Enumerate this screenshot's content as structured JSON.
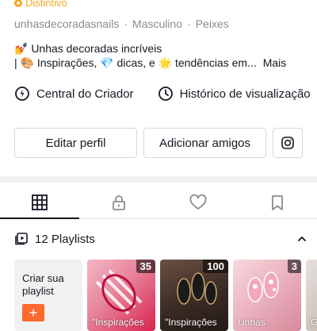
{
  "profile": {
    "badge_label": "Distintivo",
    "username": "unhasdecoradasnails",
    "gender": "Masculino",
    "sign": "Peixes",
    "bio_line1": "💅 Unhas decoradas incríveis",
    "bio_line2": "| 🎨 Inspirações, 💎 dicas, e 🌟 tendências em...",
    "bio_more": "Mais"
  },
  "links": {
    "creator_center": "Central do Criador",
    "view_history": "Histórico de visualização"
  },
  "buttons": {
    "edit_profile": "Editar perfil",
    "add_friends": "Adicionar amigos"
  },
  "tabs": [
    {
      "icon": "grid-icon",
      "active": true
    },
    {
      "icon": "lock-icon",
      "active": false
    },
    {
      "icon": "heart-icon",
      "active": false
    },
    {
      "icon": "bookmark-icon",
      "active": false
    }
  ],
  "playlists": {
    "header": "12 Playlists",
    "create_label": "Criar sua playlist",
    "items": [
      {
        "count": "35",
        "caption": "\"Inspirações",
        "colors": [
          "#f3b6c6",
          "#d9254f"
        ]
      },
      {
        "count": "100",
        "caption": "\"Inspirações",
        "colors": [
          "#6b5044",
          "#231a16"
        ]
      },
      {
        "count": "3",
        "caption": "Unhas",
        "colors": [
          "#d88a9c",
          "#f7d9de"
        ]
      }
    ],
    "partial_caption": "Go"
  },
  "colors": {
    "accent": "#fe6b2f",
    "badge": "#f5a623",
    "secondary_text": "#8a8b91"
  }
}
